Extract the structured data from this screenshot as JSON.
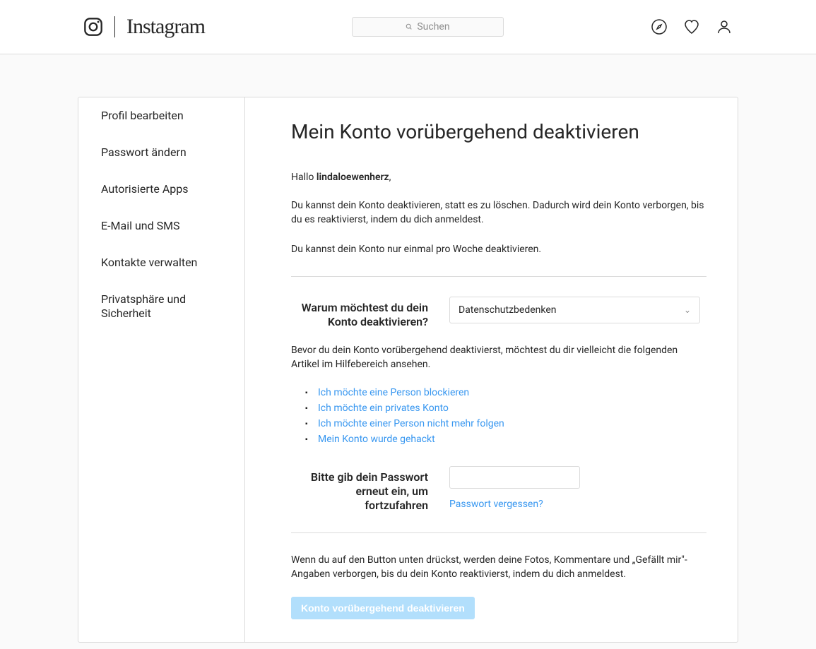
{
  "header": {
    "brand_text": "Instagram",
    "search_placeholder": "Suchen"
  },
  "sidebar": {
    "items": [
      {
        "label": "Profil bearbeiten"
      },
      {
        "label": "Passwort ändern"
      },
      {
        "label": "Autorisierte Apps"
      },
      {
        "label": "E-Mail und SMS"
      },
      {
        "label": "Kontakte verwalten"
      },
      {
        "label": "Privatsphäre und Sicherheit"
      }
    ]
  },
  "content": {
    "title": "Mein Konto vorübergehend deaktivieren",
    "greeting_prefix": "Hallo ",
    "username": "lindaloewenherz",
    "greeting_suffix": ",",
    "intro1": "Du kannst dein Konto deaktivieren, statt es zu löschen. Dadurch wird dein Konto verborgen, bis du es reaktivierst, indem du dich anmeldest.",
    "intro2": "Du kannst dein Konto nur einmal pro Woche deaktivieren.",
    "reason_label": "Warum möchtest du dein Konto deaktivieren?",
    "reason_selected": "Datenschutzbedenken",
    "help_intro": "Bevor du dein Konto vorübergehend deaktivierst, möchtest du dir vielleicht die folgenden Artikel im Hilfebereich ansehen.",
    "help_links": [
      "Ich möchte eine Person blockieren",
      "Ich möchte ein privates Konto",
      "Ich möchte einer Person nicht mehr folgen",
      "Mein Konto wurde gehackt"
    ],
    "password_label": "Bitte gib dein Passwort erneut ein, um fortzufahren",
    "forgot_password": "Passwort vergessen?",
    "final_notice": "Wenn du auf den Button unten drückst, werden deine Fotos, Kommentare und „Gefällt mir\"-Angaben verborgen, bis du dein Konto reaktivierst, indem du dich anmeldest.",
    "submit_label": "Konto vorübergehend deaktivieren"
  }
}
